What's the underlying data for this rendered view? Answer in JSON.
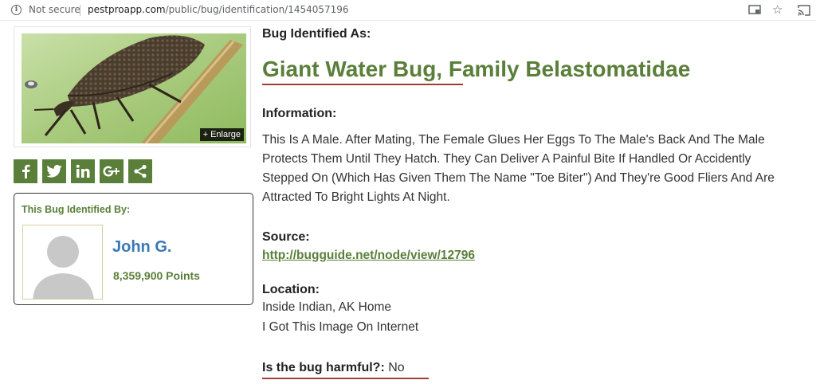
{
  "browser": {
    "security_label": "Not secure",
    "url_host": "pestproapp.com",
    "url_path": "/public/bug/identification/1454057196",
    "icons": [
      "info-icon",
      "cast-icon",
      "star-icon",
      "screen-icon"
    ]
  },
  "image": {
    "enlarge_label": "+ Enlarge"
  },
  "share": {
    "buttons": [
      {
        "icon": "facebook-icon",
        "glyph": "f"
      },
      {
        "icon": "twitter-icon",
        "glyph": "t"
      },
      {
        "icon": "linkedin-icon",
        "glyph": "in"
      },
      {
        "icon": "google-plus-icon",
        "glyph": "g+"
      },
      {
        "icon": "share-icon",
        "glyph": "<"
      }
    ],
    "color": "#5a7f3a"
  },
  "identified_by": {
    "heading": "This Bug Identified By:",
    "user_name": "John G.",
    "points": "8,359,900 Points"
  },
  "bug": {
    "identified_as_label": "Bug Identified As:",
    "name": "Giant Water Bug, Family Belastomatidae",
    "information_label": "Information:",
    "information": "This Is A Male. After Mating, The Female Glues Her Eggs To The Male's Back And The Male Protects Them Until They Hatch. They Can Deliver A Painful Bite If Handled Or Accidently Stepped On (Which Has Given Them The Name \"Toe Biter\") And They're Good Fliers And Are Attracted To Bright Lights At Night.",
    "source_label": "Source:",
    "source_link": "http://bugguide.net/node/view/12796",
    "location_label": "Location:",
    "location_line1": "Inside Indian, AK Home",
    "location_line2": "I Got This Image On Internet",
    "harmful_question": "Is the bug harmful?:",
    "harmful_answer": "No"
  },
  "colors": {
    "brand_green": "#5a7f3a",
    "user_blue": "#3a77b5",
    "underline_red": "#a33a3a"
  }
}
